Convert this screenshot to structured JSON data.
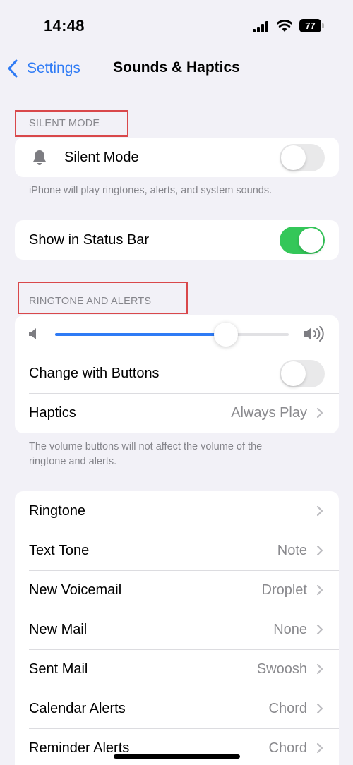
{
  "status_bar": {
    "time": "14:48",
    "battery": "77"
  },
  "nav": {
    "back_label": "Settings",
    "title": "Sounds & Haptics"
  },
  "silent_section": {
    "header": "SILENT MODE",
    "silent_mode_label": "Silent Mode",
    "silent_mode_on": false,
    "footnote": "iPhone will play ringtones, alerts, and system sounds."
  },
  "status_bar_card": {
    "label": "Show in Status Bar",
    "on": true
  },
  "ringtone_section": {
    "header": "RINGTONE AND ALERTS",
    "volume_fraction": 0.73,
    "change_with_buttons_label": "Change with Buttons",
    "change_with_buttons_on": false,
    "haptics_label": "Haptics",
    "haptics_value": "Always Play",
    "footnote_line1": "The volume buttons will not affect the volume of the",
    "footnote_line2": "ringtone and alerts."
  },
  "sounds_list": [
    {
      "label": "Ringtone",
      "value": ""
    },
    {
      "label": "Text Tone",
      "value": "Note"
    },
    {
      "label": "New Voicemail",
      "value": "Droplet"
    },
    {
      "label": "New Mail",
      "value": "None"
    },
    {
      "label": "Sent Mail",
      "value": "Swoosh"
    },
    {
      "label": "Calendar Alerts",
      "value": "Chord"
    },
    {
      "label": "Reminder Alerts",
      "value": "Chord"
    }
  ],
  "colors": {
    "accent": "#2f7bf5",
    "toggle_on": "#34c759",
    "highlight_box": "#d9484b",
    "background": "#f2f1f7"
  },
  "icons": [
    "chevron-left-icon",
    "bell-icon",
    "speaker-low-icon",
    "speaker-high-icon",
    "chevron-right-icon",
    "signal-icon",
    "wifi-icon",
    "battery-icon"
  ]
}
